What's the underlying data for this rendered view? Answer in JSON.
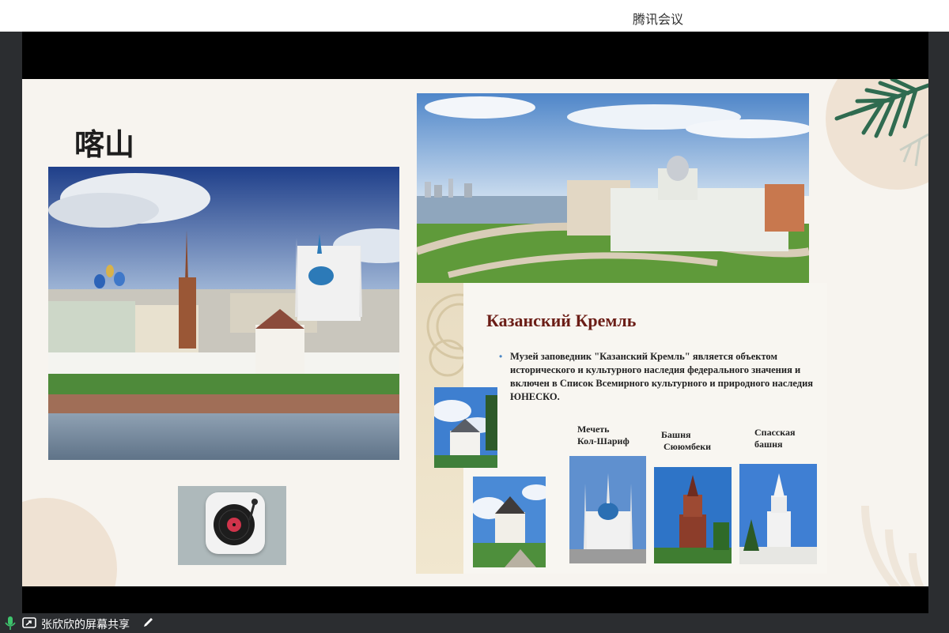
{
  "window": {
    "title": "腾讯会议"
  },
  "slide": {
    "title": "喀山",
    "heading": "Казанский Кремль",
    "description": "Музей заповедник \"Казанский Кремль\" является объектом исторического и культурного наследия федерального значения и включен в Список Всемирного культурного и природного наследия ЮНЕСКО.",
    "captions": {
      "mosque": "Мечеть\nКол-Шариф",
      "tower_suyumbike": "Башня\n Сююмбеки",
      "tower_spasskaya": "Спасская\nбашня"
    }
  },
  "statusbar": {
    "share_label": "张欣欣的屏幕共享"
  },
  "colors": {
    "heading": "#6b1d16",
    "slide_bg": "#f7f4ef",
    "frame": "#2b2d30"
  },
  "icons": [
    "microphone-icon",
    "screen-share-icon",
    "pen-icon",
    "music-player-icon"
  ]
}
